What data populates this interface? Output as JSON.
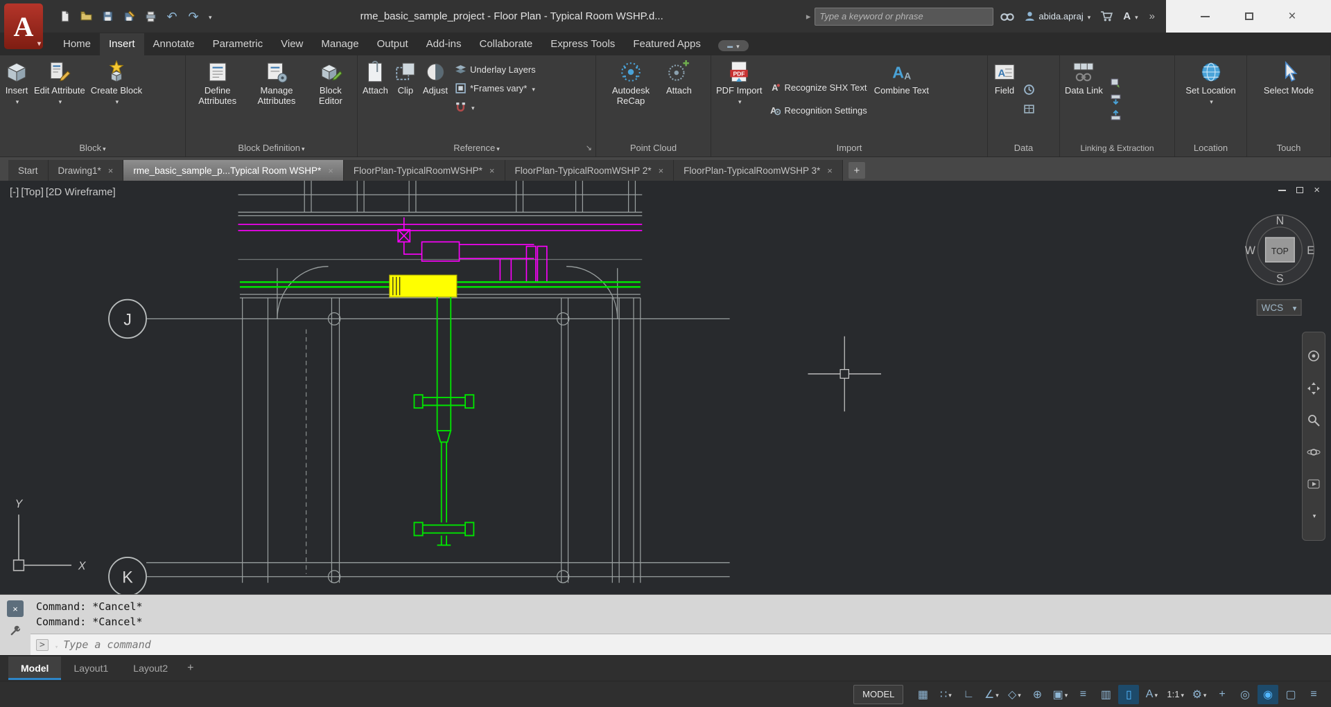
{
  "icons": {
    "caret": "▾",
    "close": "×",
    "chevrons": "»",
    "arrow_right": "▸",
    "undo": "↶",
    "redo": "↷",
    "plus": "+",
    "grid": "▦",
    "snap": "∷",
    "ortho": "∟",
    "polar": "∠",
    "isodraft": "◇",
    "otrack": "⊕",
    "osnap": "▣",
    "lineweight": "≡",
    "cycling": "▥",
    "dyninput": "▯",
    "annotation": "A",
    "gear": "⚙",
    "isolate": "◎",
    "performance": "◉",
    "cleanscreen": "▢",
    "menu": "≡",
    "launcher": "↘",
    "prompt": ">",
    "pdf_label": "PDF",
    "letter_a": "A"
  },
  "titlebar": {
    "title": "rme_basic_sample_project - Floor Plan - Typical Room WSHP.d...",
    "search_placeholder": "Type a keyword or phrase",
    "user_name": "abida.apraj"
  },
  "ribbon": {
    "tabs": [
      "Home",
      "Insert",
      "Annotate",
      "Parametric",
      "View",
      "Manage",
      "Output",
      "Add-ins",
      "Collaborate",
      "Express Tools",
      "Featured Apps"
    ],
    "panels": {
      "block": {
        "title": "Block",
        "insert": "Insert",
        "edit_attribute": "Edit Attribute",
        "create_block": "Create Block"
      },
      "block_definition": {
        "title": "Block Definition",
        "define": "Define Attributes",
        "manage": "Manage Attributes",
        "editor": "Block Editor"
      },
      "reference": {
        "title": "Reference",
        "attach": "Attach",
        "clip": "Clip",
        "adjust": "Adjust",
        "underlay": "Underlay Layers",
        "frames": "*Frames vary*"
      },
      "point_cloud": {
        "title": "Point Cloud",
        "recap": "Autodesk ReCap",
        "attach": "Attach"
      },
      "import": {
        "title": "Import",
        "pdf": "PDF Import",
        "shx": "Recognize SHX Text",
        "settings": "Recognition Settings",
        "combine": "Combine Text"
      },
      "data": {
        "title": "Data",
        "field": "Field"
      },
      "linking": {
        "title": "Linking & Extraction",
        "datalink": "Data Link"
      },
      "location": {
        "title": "Location",
        "set_location": "Set Location"
      },
      "touch": {
        "title": "Touch",
        "select_mode": "Select Mode"
      }
    }
  },
  "file_tabs": [
    "Start",
    "Drawing1*",
    "rme_basic_sample_p...Typical Room WSHP*",
    "FloorPlan-TypicalRoomWSHP*",
    "FloorPlan-TypicalRoomWSHP 2*",
    "FloorPlan-TypicalRoomWSHP 3*"
  ],
  "viewport": {
    "control_pane": "[-]",
    "control_view": "[Top]",
    "control_visual": "[2D Wireframe]",
    "compass_n": "N",
    "compass_s": "S",
    "compass_e": "E",
    "compass_w": "W",
    "compass_center": "TOP",
    "wcs_label": "WCS",
    "ucs_x": "X",
    "ucs_y": "Y",
    "grid_bubble_j": "J",
    "grid_bubble_k": "K"
  },
  "command": {
    "line1": "Command: *Cancel*",
    "line2": "Command: *Cancel*",
    "prompt_placeholder": "Type a command"
  },
  "layout_tabs": {
    "model": "Model",
    "layout1": "Layout1",
    "layout2": "Layout2"
  },
  "status": {
    "model_label": "MODEL",
    "scale": "1:1"
  },
  "colors": {
    "magenta": "#ff00ff",
    "green": "#00e400",
    "yellow": "#ffff00",
    "accent_blue": "#8fb6d4",
    "highlight_blue": "#52b7ff"
  }
}
